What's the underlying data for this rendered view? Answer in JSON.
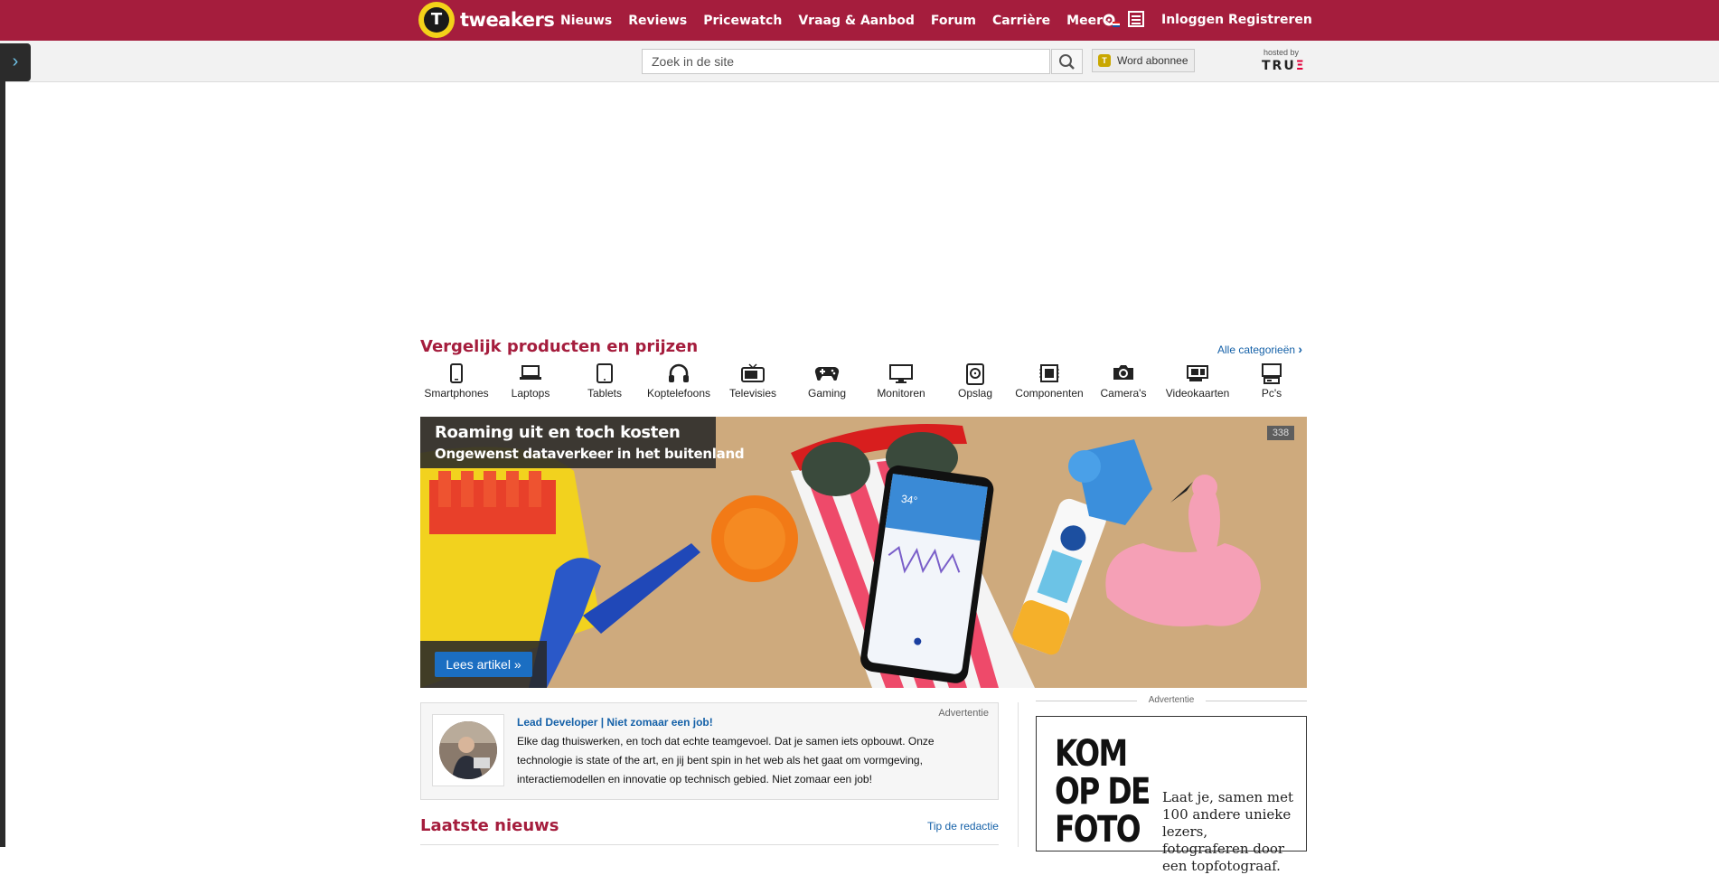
{
  "header": {
    "brand": "tweakers",
    "logo_letter": "T",
    "nav": [
      "Nieuws",
      "Reviews",
      "Pricewatch",
      "Vraag & Aanbod",
      "Forum",
      "Carrière",
      "Meer"
    ],
    "login": "Inloggen",
    "register": "Registreren"
  },
  "subbar": {
    "search_placeholder": "Zoek in de site",
    "subscribe": "Word abonnee",
    "hosted_by": "hosted by",
    "host_brand_main": "TRU",
    "host_brand_accent": "Ξ"
  },
  "compare": {
    "title": "Vergelijk producten en prijzen",
    "all_categories": "Alle categorieën",
    "categories": [
      {
        "label": "Smartphones",
        "icon": "smartphone-icon"
      },
      {
        "label": "Laptops",
        "icon": "laptop-icon"
      },
      {
        "label": "Tablets",
        "icon": "tablet-icon"
      },
      {
        "label": "Koptelefoons",
        "icon": "headphones-icon"
      },
      {
        "label": "Televisies",
        "icon": "tv-icon"
      },
      {
        "label": "Gaming",
        "icon": "gamepad-icon"
      },
      {
        "label": "Monitoren",
        "icon": "monitor-icon"
      },
      {
        "label": "Opslag",
        "icon": "storage-icon"
      },
      {
        "label": "Componenten",
        "icon": "chip-icon"
      },
      {
        "label": "Camera's",
        "icon": "camera-icon"
      },
      {
        "label": "Videokaarten",
        "icon": "gpu-icon"
      },
      {
        "label": "Pc's",
        "icon": "pc-icon"
      }
    ]
  },
  "hero": {
    "title": "Roaming uit en toch kosten",
    "subtitle": "Ongewenst dataverkeer in het buitenland",
    "comment_count": "338",
    "button": "Lees artikel »",
    "phone_temp": "34°"
  },
  "job_ad": {
    "label": "Advertentie",
    "title": "Lead Developer | Niet zomaar een job!",
    "text": "Elke dag thuiswerken, en toch dat echte teamgevoel. Dat je samen iets opbouwt. Onze technologie is state of the art, en jij bent spin in het web als het gaat om vormgeving, interactiemodellen en innovatie op technisch gebied. Niet zomaar een job!"
  },
  "news": {
    "title": "Laatste nieuws",
    "tip": "Tip de redactie"
  },
  "side_ad": {
    "label": "Advertentie",
    "headline": "KOM OP DE FOTO",
    "text": "Laat je, samen met 100 andere unieke lezers, fotograferen door een topfotograaf."
  },
  "colors": {
    "brand": "#a51d3d",
    "link": "#1561a8",
    "logo_yellow": "#f3d219"
  }
}
